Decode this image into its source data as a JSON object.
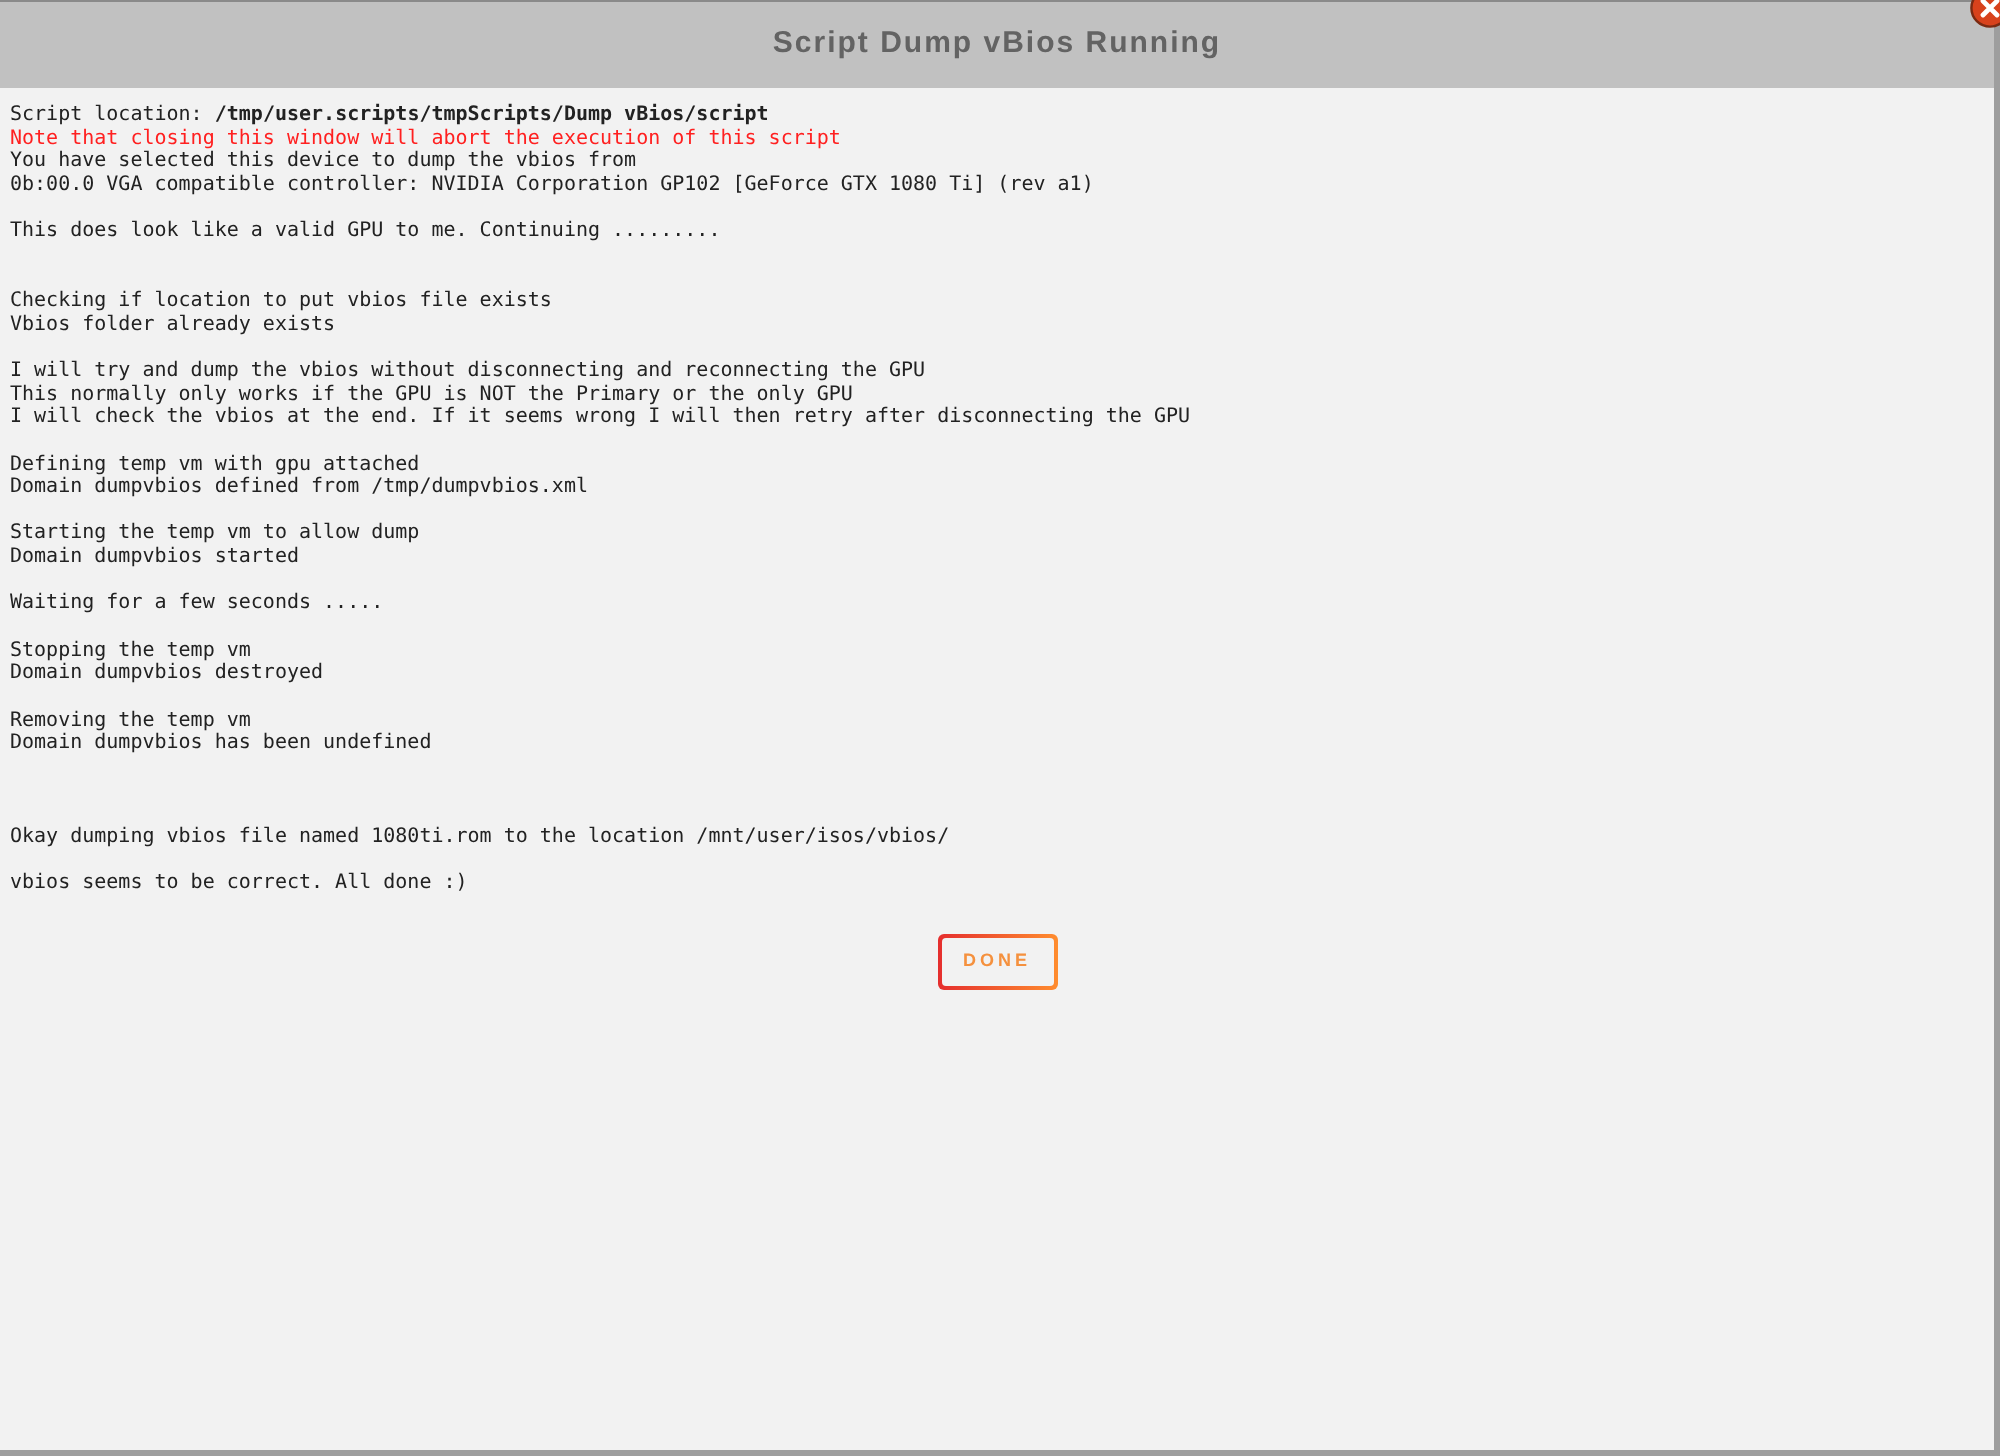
{
  "dialog": {
    "title": "Script Dump vBios Running",
    "output_lines": [
      {
        "kind": "text",
        "text": "Script location: **/tmp/user.scripts/tmpScripts/Dump vBios/script**"
      },
      {
        "kind": "warning",
        "text": "Note that closing this window will abort the execution of this script"
      },
      {
        "kind": "text",
        "text": "You have selected this device to dump the vbios from"
      },
      {
        "kind": "text",
        "text": "0b:00.0 VGA compatible controller: NVIDIA Corporation GP102 [GeForce GTX 1080 Ti] (rev a1)"
      },
      {
        "kind": "blank"
      },
      {
        "kind": "text",
        "text": "This does look like a valid GPU to me. Continuing ........."
      },
      {
        "kind": "blank"
      },
      {
        "kind": "blank"
      },
      {
        "kind": "text",
        "text": "Checking if location to put vbios file exists"
      },
      {
        "kind": "text",
        "text": "Vbios folder already exists"
      },
      {
        "kind": "blank"
      },
      {
        "kind": "text",
        "text": "I will try and dump the vbios without disconnecting and reconnecting the GPU"
      },
      {
        "kind": "text",
        "text": "This normally only works if the GPU is NOT the Primary or the only GPU"
      },
      {
        "kind": "text",
        "text": "I will check the vbios at the end. If it seems wrong I will then retry after disconnecting the GPU"
      },
      {
        "kind": "blank"
      },
      {
        "kind": "text",
        "text": "Defining temp vm with gpu attached"
      },
      {
        "kind": "text",
        "text": "Domain dumpvbios defined from /tmp/dumpvbios.xml"
      },
      {
        "kind": "blank"
      },
      {
        "kind": "text",
        "text": "Starting the temp vm to allow dump"
      },
      {
        "kind": "text",
        "text": "Domain dumpvbios started"
      },
      {
        "kind": "blank"
      },
      {
        "kind": "text",
        "text": "Waiting for a few seconds ....."
      },
      {
        "kind": "blank"
      },
      {
        "kind": "text",
        "text": "Stopping the temp vm"
      },
      {
        "kind": "text",
        "text": "Domain dumpvbios destroyed"
      },
      {
        "kind": "blank"
      },
      {
        "kind": "text",
        "text": "Removing the temp vm"
      },
      {
        "kind": "text",
        "text": "Domain dumpvbios has been undefined"
      },
      {
        "kind": "blank"
      },
      {
        "kind": "blank"
      },
      {
        "kind": "blank"
      },
      {
        "kind": "text",
        "text": "Okay dumping vbios file named 1080ti.rom to the location /mnt/user/isos/vbios/"
      },
      {
        "kind": "blank"
      },
      {
        "kind": "text",
        "text": "vbios seems to be correct. All done :)"
      }
    ],
    "buttons": [
      {
        "label": "DONE"
      }
    ]
  }
}
